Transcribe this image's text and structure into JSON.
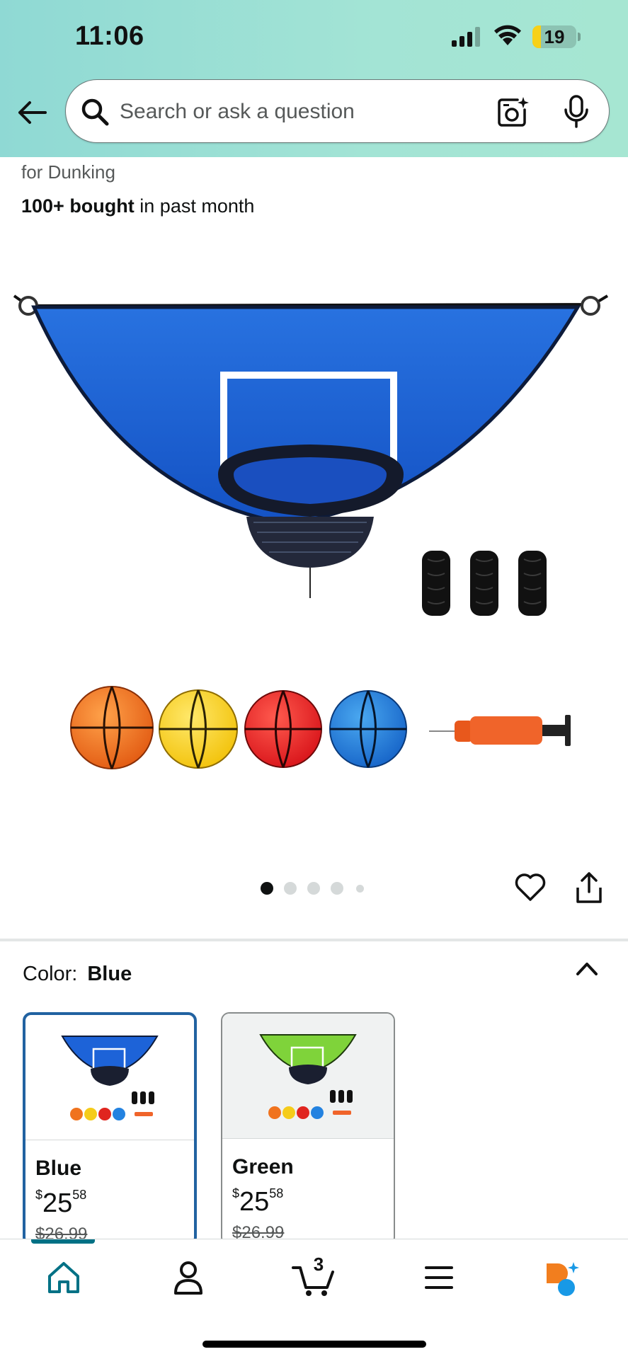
{
  "status_bar": {
    "time": "11:06",
    "battery_level": "19",
    "battery_fraction": 0.19
  },
  "header": {
    "back_icon": "arrow-left-icon",
    "search_placeholder": "Search or ask a question",
    "camera_icon": "camera-sparkle-icon",
    "mic_icon": "microphone-icon"
  },
  "product": {
    "title_tail": "for Dunking",
    "bought_bold": "100+ bought",
    "bought_rest": " in past month",
    "image_dots": {
      "total": 5,
      "active": 0
    },
    "heart_icon": "heart-icon",
    "share_icon": "share-icon"
  },
  "color_selector": {
    "label": "Color:",
    "value": "Blue",
    "collapse_icon": "chevron-up-icon",
    "options": [
      {
        "name": "Blue",
        "currency": "$",
        "whole": "25",
        "fraction": "58",
        "list_price": "$26.99",
        "color": "#1d63d8",
        "selected": true
      },
      {
        "name": "Green",
        "currency": "$",
        "whole": "25",
        "fraction": "58",
        "list_price": "$26.99",
        "color": "#7fd33a",
        "selected": false
      }
    ]
  },
  "bottom_nav": {
    "items": [
      {
        "icon": "home-icon",
        "active": true
      },
      {
        "icon": "account-icon",
        "active": false
      },
      {
        "icon": "cart-icon",
        "active": false,
        "badge": "3"
      },
      {
        "icon": "menu-icon",
        "active": false
      },
      {
        "icon": "rufus-assistant-icon",
        "active": false
      }
    ]
  },
  "colors": {
    "header_teal": "#a3e4d5",
    "accent_teal": "#007185",
    "selected_border": "#2162a1",
    "assistant_orange": "#f27e1e",
    "assistant_blue": "#1899e6"
  }
}
